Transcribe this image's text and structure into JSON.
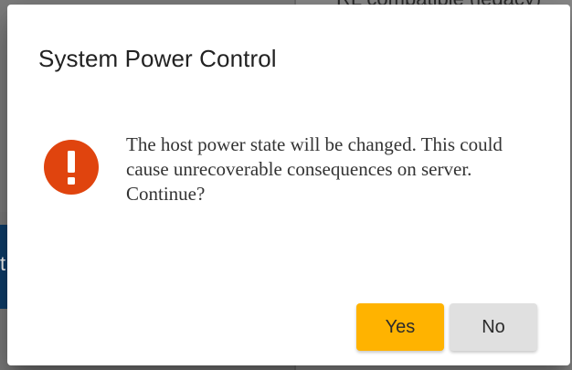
{
  "background": {
    "top_text": "RL compatible (legacy)",
    "side_text": "t"
  },
  "dialog": {
    "title": "System Power Control",
    "icon": "exclamation-icon",
    "icon_color": "#e0440e",
    "message": "The host power state will be changed. This could cause unrecoverable consequences on server. Continue?",
    "buttons": {
      "yes_label": "Yes",
      "no_label": "No"
    },
    "colors": {
      "yes_button": "#ffb300",
      "no_button": "#e0e0e0"
    }
  }
}
